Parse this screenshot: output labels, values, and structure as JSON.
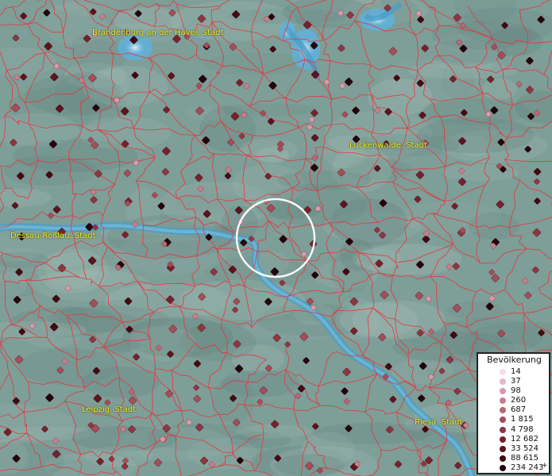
{
  "map": {
    "title": "",
    "background_color": "#7e9e98",
    "boundary_color": "#e8323a",
    "river_color": "#4a9ec8",
    "highlight_circle_color": "#ffffff"
  },
  "cities": [
    {
      "id": "brandenburg",
      "label": "Brandenburg an der Havel, Stadt"
    },
    {
      "id": "luckenwalde",
      "label": "Luckenwalde, Stadt"
    },
    {
      "id": "dessau",
      "label": "Dessau-Roßlau, Stadt"
    },
    {
      "id": "leipzig",
      "label": "Leipzig, Stadt"
    },
    {
      "id": "riesa",
      "label": "Riesa, Stadt"
    }
  ],
  "legend": {
    "title": "Bevölkerung",
    "items": [
      {
        "label": "14",
        "color": "#f8dce6"
      },
      {
        "label": "37",
        "color": "#e9b6c6"
      },
      {
        "label": "98",
        "color": "#d99aaa"
      },
      {
        "label": "260",
        "color": "#c8808e"
      },
      {
        "label": "687",
        "color": "#b86774"
      },
      {
        "label": "1 815",
        "color": "#a44e5a"
      },
      {
        "label": "4 798",
        "color": "#8e3642"
      },
      {
        "label": "12 682",
        "color": "#76222e"
      },
      {
        "label": "33 524",
        "color": "#5c141e"
      },
      {
        "label": "88 615",
        "color": "#420a12"
      },
      {
        "label": "234 243",
        "color": "#22050a"
      }
    ],
    "plus_marker": "+"
  }
}
